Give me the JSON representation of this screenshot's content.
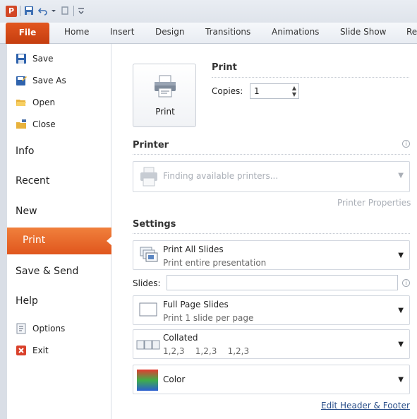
{
  "ribbon": {
    "file_tab": "File",
    "tabs": [
      "Home",
      "Insert",
      "Design",
      "Transitions",
      "Animations",
      "Slide Show",
      "Re"
    ]
  },
  "nav": {
    "save": "Save",
    "save_as": "Save As",
    "open": "Open",
    "close": "Close",
    "info": "Info",
    "recent": "Recent",
    "new": "New",
    "print": "Print",
    "save_send": "Save & Send",
    "help": "Help",
    "options": "Options",
    "exit": "Exit"
  },
  "print_section": {
    "title": "Print",
    "button_label": "Print",
    "copies_label": "Copies:",
    "copies_value": "1"
  },
  "printer_section": {
    "title": "Printer",
    "status": "Finding available printers...",
    "properties_link": "Printer Properties"
  },
  "settings_section": {
    "title": "Settings",
    "slides_option": {
      "title": "Print All Slides",
      "subtitle": "Print entire presentation"
    },
    "slides_label": "Slides:",
    "slides_value": "",
    "layout_option": {
      "title": "Full Page Slides",
      "subtitle": "Print 1 slide per page"
    },
    "collation_option": {
      "title": "Collated",
      "subtitle": "1,2,3    1,2,3    1,2,3"
    },
    "color_option": {
      "title": "Color"
    },
    "footer_link": "Edit Header & Footer"
  },
  "colors": {
    "accent": "#e0561d",
    "file_tab": "#c53d0f",
    "link": "#2a4f8a"
  },
  "icons": {
    "info": "info-circle-icon",
    "printer": "printer-icon",
    "dropdown": "chevron-down-icon"
  }
}
